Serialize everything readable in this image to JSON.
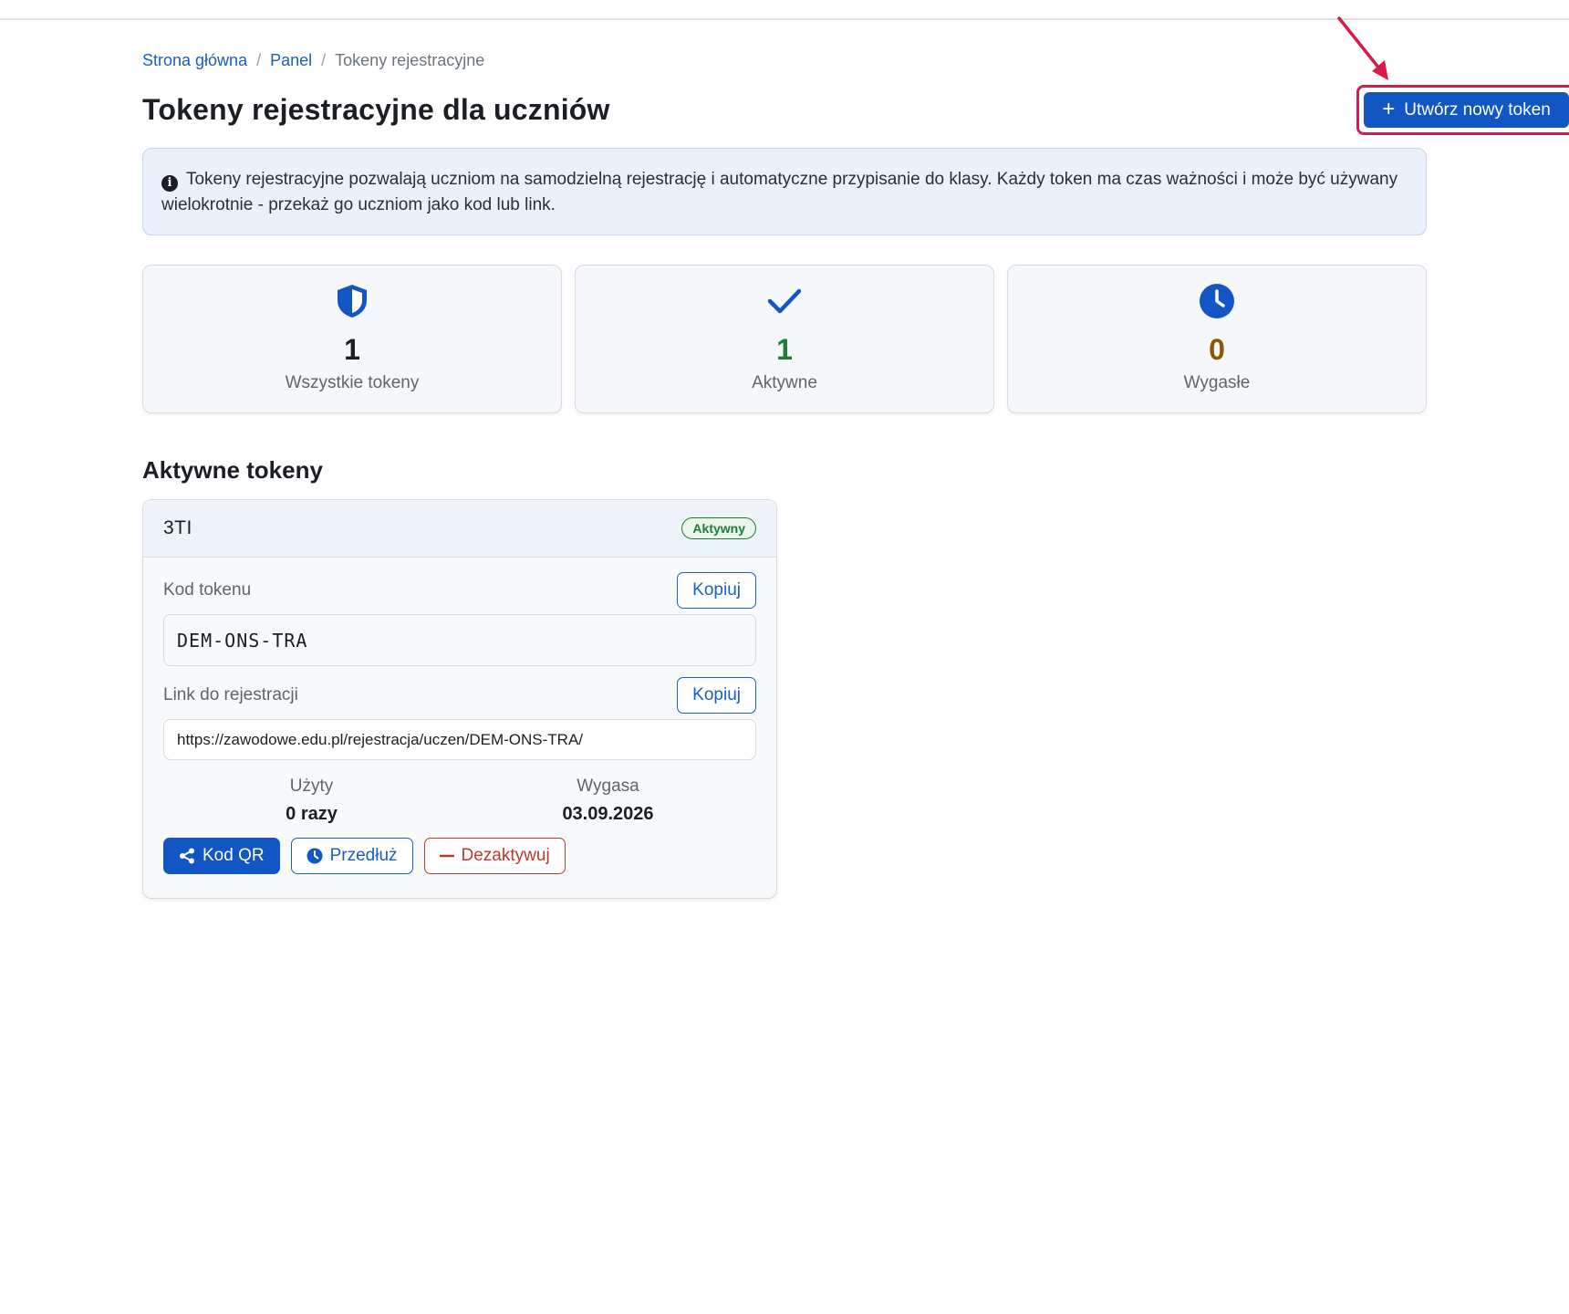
{
  "breadcrumb": {
    "home": "Strona główna",
    "panel": "Panel",
    "current": "Tokeny rejestracyjne",
    "separator": "/"
  },
  "page": {
    "title": "Tokeny rejestracyjne dla uczniów",
    "create_button": "Utwórz nowy token",
    "create_button_icon": "plus-icon"
  },
  "info": {
    "icon": "info-icon",
    "text": "Tokeny rejestracyjne pozwalają uczniom na samodzielną rejestrację i automatyczne przypisanie do klasy. Każdy token ma czas ważności i może być używany wielokrotnie - przekaż go uczniom jako kod lub link."
  },
  "stats": [
    {
      "icon": "shield-icon",
      "value": "1",
      "label": "Wszystkie tokeny",
      "color": "#1b1f23"
    },
    {
      "icon": "check-icon",
      "value": "1",
      "label": "Aktywne",
      "color": "#1e7d34"
    },
    {
      "icon": "clock-icon",
      "value": "0",
      "label": "Wygasłe",
      "color": "#8a5a00"
    }
  ],
  "section": {
    "title": "Aktywne tokeny"
  },
  "token": {
    "name": "3TI",
    "status": "Aktywny",
    "code_label": "Kod tokenu",
    "code": "DEM-ONS-TRA",
    "copy_label": "Kopiuj",
    "link_label": "Link do rejestracji",
    "link": "https://zawodowe.edu.pl/rejestracja/uczen/DEM-ONS-TRA/",
    "used_label": "Użyty",
    "used_value": "0 razy",
    "expires_label": "Wygasa",
    "expires_value": "03.09.2026",
    "actions": {
      "qr": "Kod QR",
      "extend": "Przedłuż",
      "deactivate": "Dezaktywuj"
    }
  },
  "colors": {
    "primary": "#1256c4",
    "success": "#1e7d34",
    "warning": "#8a5a00",
    "danger": "#c0392b",
    "annotation": "#d81b4a"
  }
}
